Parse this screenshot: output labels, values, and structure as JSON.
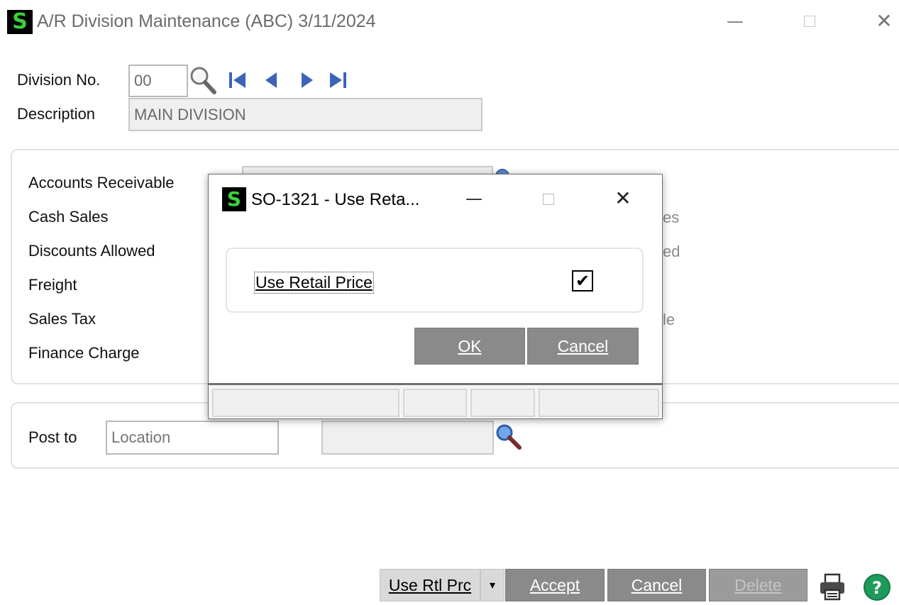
{
  "window": {
    "logo": "S",
    "title": "A/R Division Maintenance (ABC) 3/11/2024",
    "minimize_glyph": "—",
    "close_glyph": "✕"
  },
  "form": {
    "division_label": "Division No.",
    "division_value": "00",
    "description_label": "Description",
    "description_value": "MAIN DIVISION"
  },
  "accounts": {
    "labels": [
      "Accounts Receivable",
      "Cash Sales",
      "Discounts Allowed",
      "Freight",
      "Sales Tax",
      "Finance Charge"
    ],
    "partial_right": [
      "es",
      "ed",
      "le"
    ]
  },
  "post": {
    "label": "Post to",
    "placeholder": "Location"
  },
  "footer": {
    "use_rtl_prc": "Use Rtl Prc",
    "dropdown_glyph": "▾",
    "accept": "Accept",
    "cancel": "Cancel",
    "delete": "Delete"
  },
  "dialog": {
    "logo": "S",
    "title": "SO-1321 - Use Reta...",
    "minimize_glyph": "—",
    "close_glyph": "✕",
    "checkbox_label": "Use Retail Price",
    "checked": true,
    "check_glyph": "✔",
    "ok": "OK",
    "cancel": "Cancel"
  },
  "colors": {
    "brand_green": "#3cd13c",
    "nav_blue": "#3d63b8",
    "button_gray": "#8a8a8a",
    "help_green": "#1e9a5a"
  }
}
